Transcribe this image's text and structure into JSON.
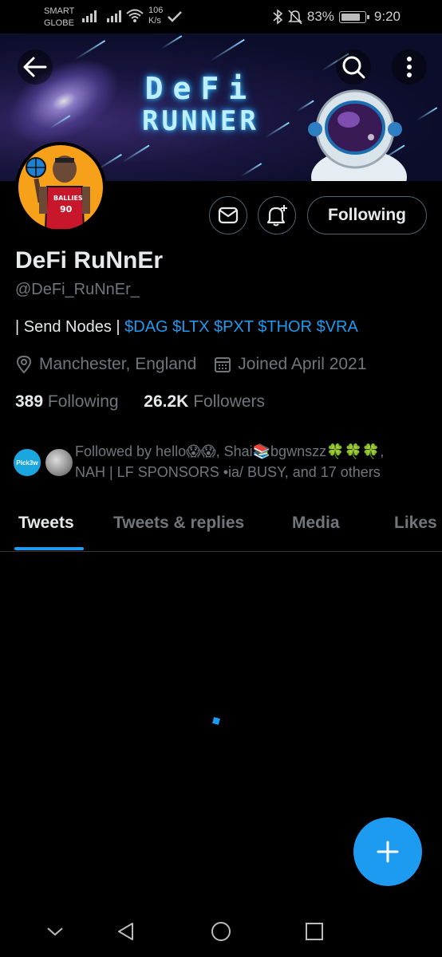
{
  "status_bar": {
    "carrier_line1": "SMART",
    "carrier_line2": "GLOBE",
    "net_speed_value": "106",
    "net_speed_unit": "K/s",
    "battery": "83%",
    "battery_level": 0.83,
    "time": "9:20"
  },
  "banner": {
    "title_line1": "DeFi",
    "title_line2": "RUNNER"
  },
  "avatar": {
    "jersey_text": "BALLIES",
    "jersey_number": "90"
  },
  "actions": {
    "following_label": "Following"
  },
  "profile": {
    "name": "DeFi RuNnEr",
    "handle": "@DeFi_RuNnEr_",
    "bio_prefix": "| Send Nodes | ",
    "bio_tags": "$DAG $LTX $PXT $THOR $VRA",
    "location": "Manchester, England",
    "joined": "Joined April 2021",
    "following_count": "389",
    "following_label": "Following",
    "followers_count": "26.2K",
    "followers_label": "Followers"
  },
  "followed_by": {
    "avatar1_text": "Pick3w",
    "line1": "Followed by hello😱😱, Shai📚bgwnszz🍀🍀🍀,",
    "line2": "NAH | LF SPONSORS •ia/ BUSY, and 17 others"
  },
  "tabs": [
    {
      "label": "Tweets"
    },
    {
      "label": "Tweets & replies"
    },
    {
      "label": "Media"
    },
    {
      "label": "Likes"
    }
  ],
  "colors": {
    "accent": "#1d9bf0",
    "background": "#000000",
    "secondary_text": "#71767b",
    "avatar_bg": "#f7a11b"
  },
  "icons": {
    "back": "back-arrow-icon",
    "search": "search-icon",
    "more": "more-vertical-icon",
    "message": "mail-icon",
    "notify": "bell-plus-icon",
    "location": "location-pin-icon",
    "calendar": "calendar-icon",
    "compose": "plus-icon"
  }
}
